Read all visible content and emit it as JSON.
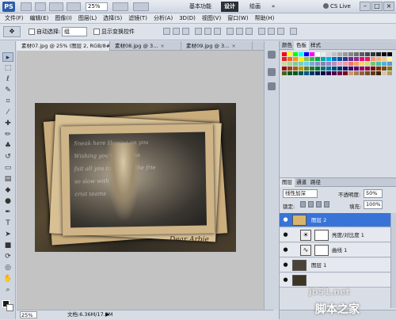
{
  "app": {
    "logo": "PS",
    "zoom_value": "25%",
    "workspaces": [
      "基本功能",
      "设计",
      "绘画",
      "»"
    ],
    "cs_live": "CS Live"
  },
  "menu": [
    "文件(F)",
    "编辑(E)",
    "图像(I)",
    "图层(L)",
    "选择(S)",
    "滤镜(T)",
    "分析(A)",
    "3D(D)",
    "视图(V)",
    "窗口(W)",
    "帮助(H)"
  ],
  "options": {
    "auto_select_label": "自动选择:",
    "auto_select_value": "组",
    "show_transform_label": "显示变换控件"
  },
  "document": {
    "tabs": [
      {
        "label": "素材07.jpg @ 25% (图层 2, RGB/8#) *",
        "active": true
      },
      {
        "label": "素材08.jpg @ 3...",
        "active": false
      },
      {
        "label": "素材09.jpg @ 3...",
        "active": false
      }
    ],
    "chalk_lines": [
      "Sneak         here Hoping on you",
      "Wishing      you're with me",
      "fait        all you to ground the frie",
      "         so slow with",
      "    crist  teams"
    ],
    "signature": "Dear Arbie"
  },
  "status": {
    "zoom": "25%",
    "doc_info": "文档:6.36M/17.0M",
    "arrow": "▶"
  },
  "panels": {
    "swatch_tabs": [
      "颜色",
      "色板",
      "样式"
    ],
    "swatch_colors": [
      "#ff0000",
      "#ffff00",
      "#00ff00",
      "#00ffff",
      "#0000ff",
      "#ff00ff",
      "#ffffff",
      "#ebebeb",
      "#d6d6d6",
      "#c2c2c2",
      "#adadad",
      "#999999",
      "#858585",
      "#707070",
      "#5c5c5c",
      "#474747",
      "#333333",
      "#1f1f1f",
      "#0a0a0a",
      "#000000",
      "#ed1c24",
      "#f26522",
      "#f7941d",
      "#fff200",
      "#8dc63f",
      "#39b54a",
      "#00a651",
      "#00a99d",
      "#00aeef",
      "#0072bc",
      "#0054a6",
      "#2e3192",
      "#662d91",
      "#92278f",
      "#ec008c",
      "#ed145b",
      "#f69679",
      "#f9ad81",
      "#fdc689",
      "#fff799",
      "#c4df9b",
      "#a3d39c",
      "#82ca9c",
      "#7accc8",
      "#6dcff6",
      "#7da7d9",
      "#8393ca",
      "#8781bd",
      "#a186be",
      "#bd8cbf",
      "#f49ac1",
      "#f5989d",
      "#ff6f6f",
      "#f2a35b",
      "#ffd65a",
      "#cfe26b",
      "#74c776",
      "#49c1a4",
      "#3fb7e6",
      "#6d8fd6",
      "#9e0b0f",
      "#a0410d",
      "#a36209",
      "#aba000",
      "#598527",
      "#1a7b30",
      "#007236",
      "#00746b",
      "#0076a3",
      "#004a80",
      "#003471",
      "#1b1464",
      "#440e62",
      "#630460",
      "#9e005d",
      "#9e0039",
      "#790000",
      "#7b2e00",
      "#7d4900",
      "#827b00",
      "#406618",
      "#005e20",
      "#005826",
      "#005952",
      "#005b7f",
      "#003663",
      "#002157",
      "#0d004c",
      "#32004b",
      "#4b0049",
      "#7b0046",
      "#7a0026",
      "#c69c6d",
      "#a67c52",
      "#8c6239",
      "#754c24",
      "#603913",
      "#3c2415",
      "#d7c6a5",
      "#b09a74"
    ],
    "layer_tabs": [
      "图层",
      "通道",
      "路径"
    ],
    "blend_mode": "线性加深",
    "opacity_label": "不透明度:",
    "opacity_value": "50%",
    "lock_label": "锁定:",
    "fill_label": "填充:",
    "fill_value": "100%",
    "layers": [
      {
        "name": "图层 2",
        "selected": true,
        "type": "pixel"
      },
      {
        "name": "亮度/对比度 1",
        "selected": false,
        "type": "adjustment"
      },
      {
        "name": "曲线 1",
        "selected": false,
        "type": "adjustment"
      },
      {
        "name": "图层 1",
        "selected": false,
        "type": "pixel"
      },
      {
        "name": "",
        "selected": false,
        "type": "pixel"
      }
    ]
  },
  "watermark": {
    "site": "jb51.net",
    "name": "脚本之家"
  }
}
